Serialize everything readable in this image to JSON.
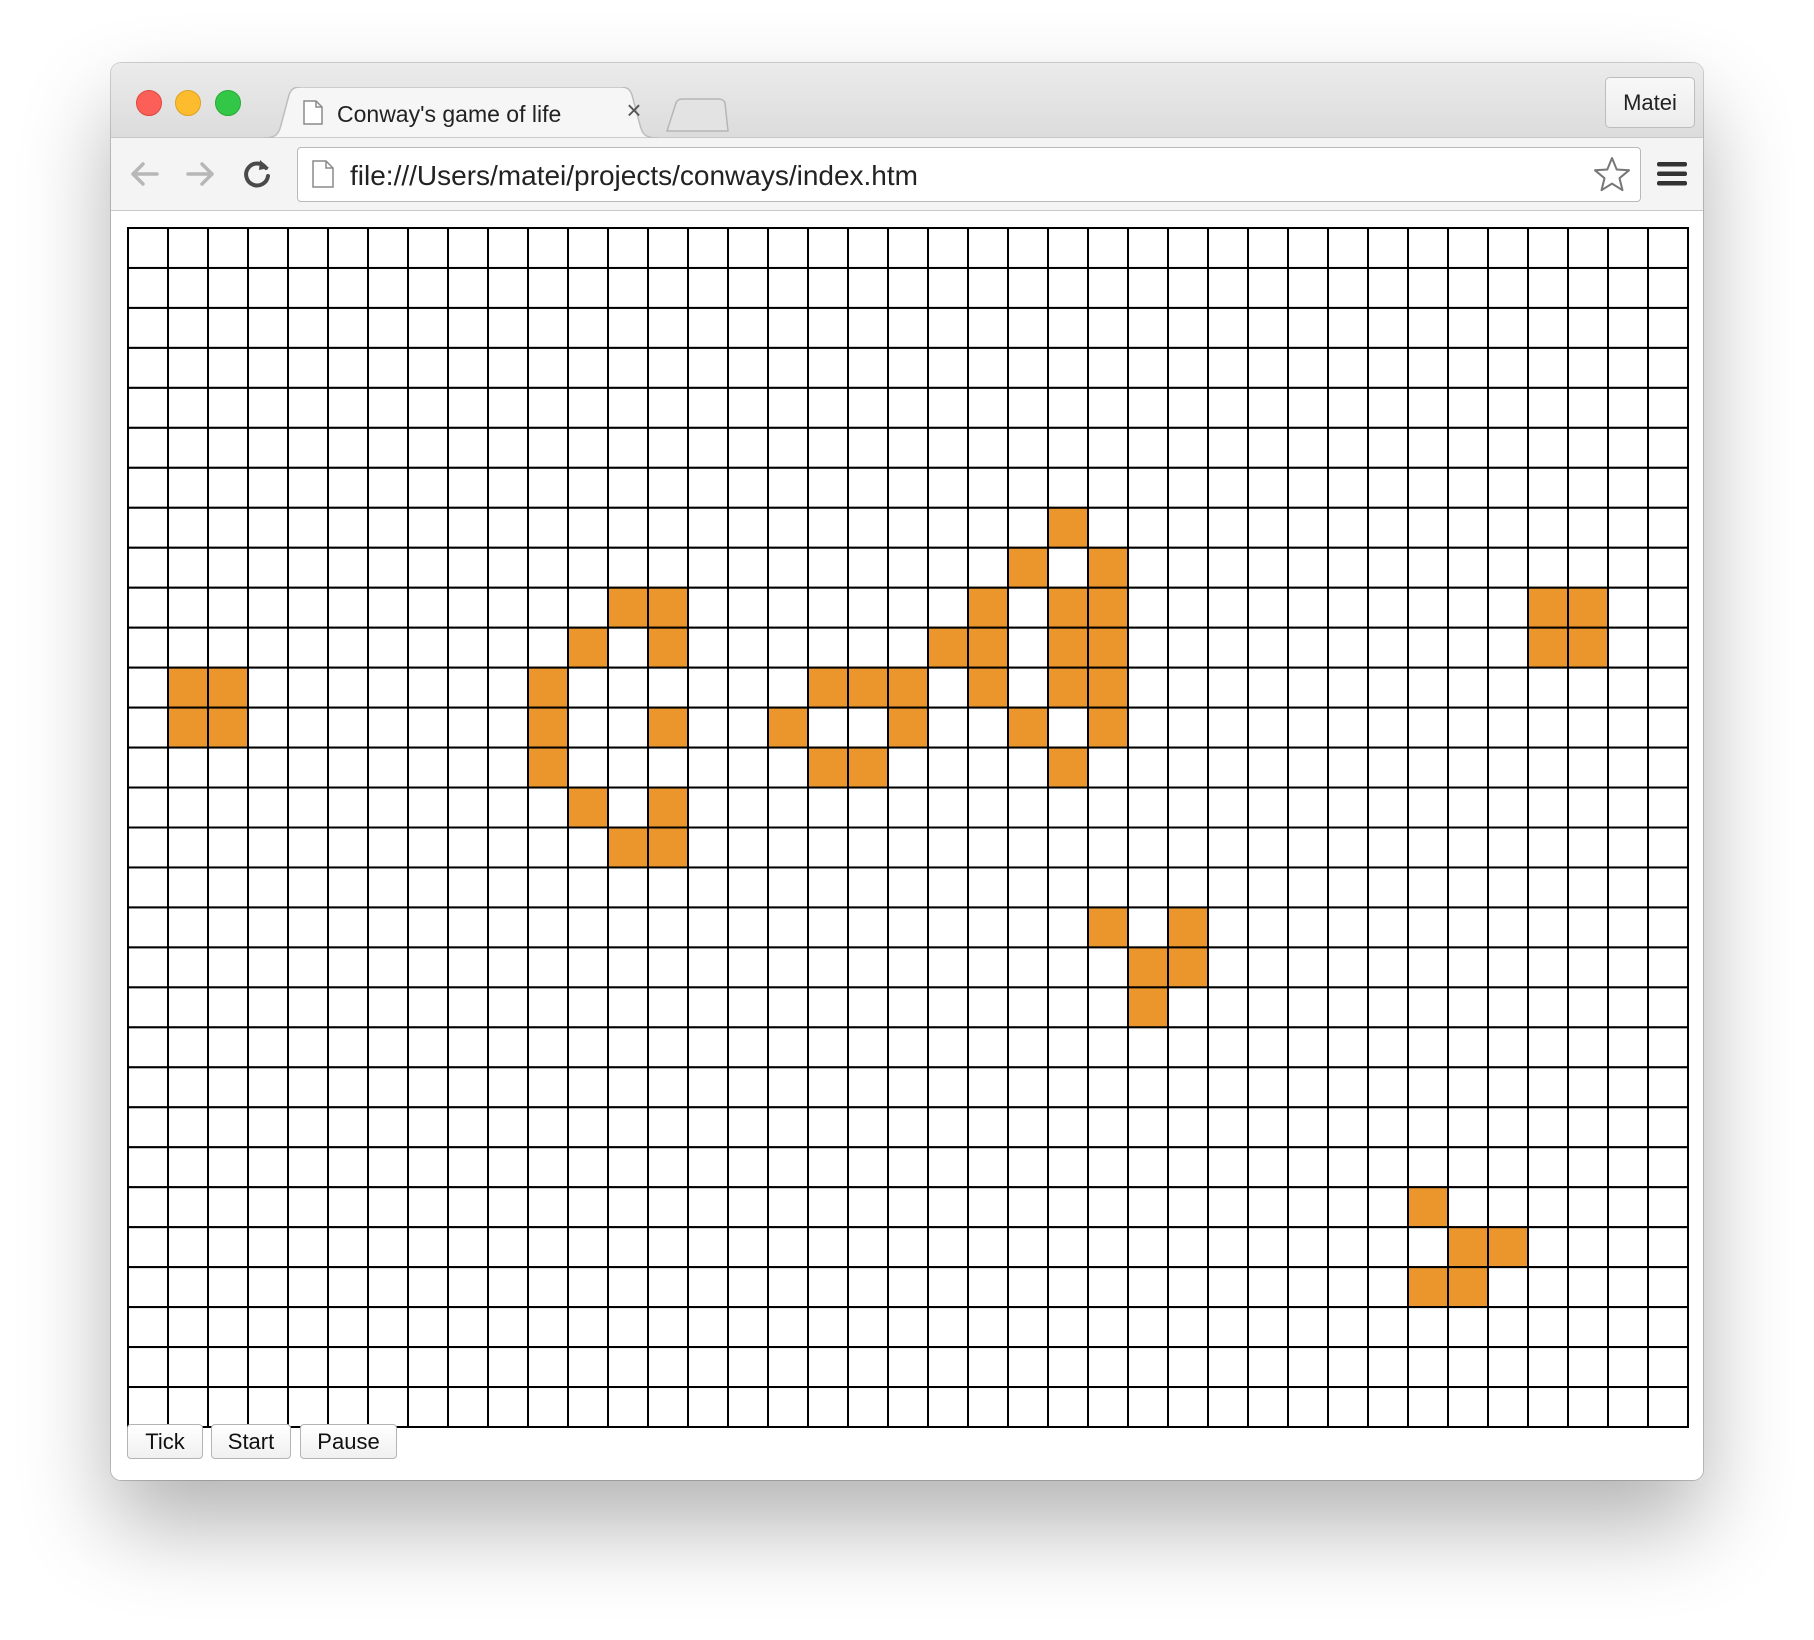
{
  "browser": {
    "tab_title": "Conway's game of life",
    "tab_close_glyph": "×",
    "profile_name": "Matei",
    "url": "file:///Users/matei/projects/conways/index.htm",
    "icons": [
      "back-arrow-icon",
      "forward-arrow-icon",
      "reload-icon",
      "page-icon",
      "bookmark-star-icon",
      "menu-icon"
    ]
  },
  "board": {
    "cols": 39,
    "rows": 30,
    "live_color": "#eb962d",
    "dead_color": "#ffffff",
    "grid_color": "#000000",
    "live_cells": [
      [
        7,
        23
      ],
      [
        8,
        22
      ],
      [
        8,
        24
      ],
      [
        9,
        12
      ],
      [
        9,
        13
      ],
      [
        9,
        21
      ],
      [
        9,
        23
      ],
      [
        9,
        24
      ],
      [
        9,
        35
      ],
      [
        9,
        36
      ],
      [
        10,
        11
      ],
      [
        10,
        13
      ],
      [
        10,
        20
      ],
      [
        10,
        21
      ],
      [
        10,
        23
      ],
      [
        10,
        24
      ],
      [
        10,
        35
      ],
      [
        10,
        36
      ],
      [
        11,
        1
      ],
      [
        11,
        2
      ],
      [
        11,
        10
      ],
      [
        11,
        17
      ],
      [
        11,
        18
      ],
      [
        11,
        19
      ],
      [
        11,
        21
      ],
      [
        11,
        23
      ],
      [
        11,
        24
      ],
      [
        12,
        1
      ],
      [
        12,
        2
      ],
      [
        12,
        10
      ],
      [
        12,
        13
      ],
      [
        12,
        16
      ],
      [
        12,
        19
      ],
      [
        12,
        22
      ],
      [
        12,
        24
      ],
      [
        13,
        10
      ],
      [
        13,
        17
      ],
      [
        13,
        18
      ],
      [
        13,
        23
      ],
      [
        14,
        11
      ],
      [
        14,
        13
      ],
      [
        15,
        12
      ],
      [
        15,
        13
      ],
      [
        17,
        24
      ],
      [
        17,
        26
      ],
      [
        18,
        25
      ],
      [
        18,
        26
      ],
      [
        19,
        25
      ],
      [
        24,
        32
      ],
      [
        25,
        33
      ],
      [
        25,
        34
      ],
      [
        26,
        32
      ],
      [
        26,
        33
      ]
    ]
  },
  "controls": {
    "tick_label": "Tick",
    "start_label": "Start",
    "pause_label": "Pause"
  }
}
